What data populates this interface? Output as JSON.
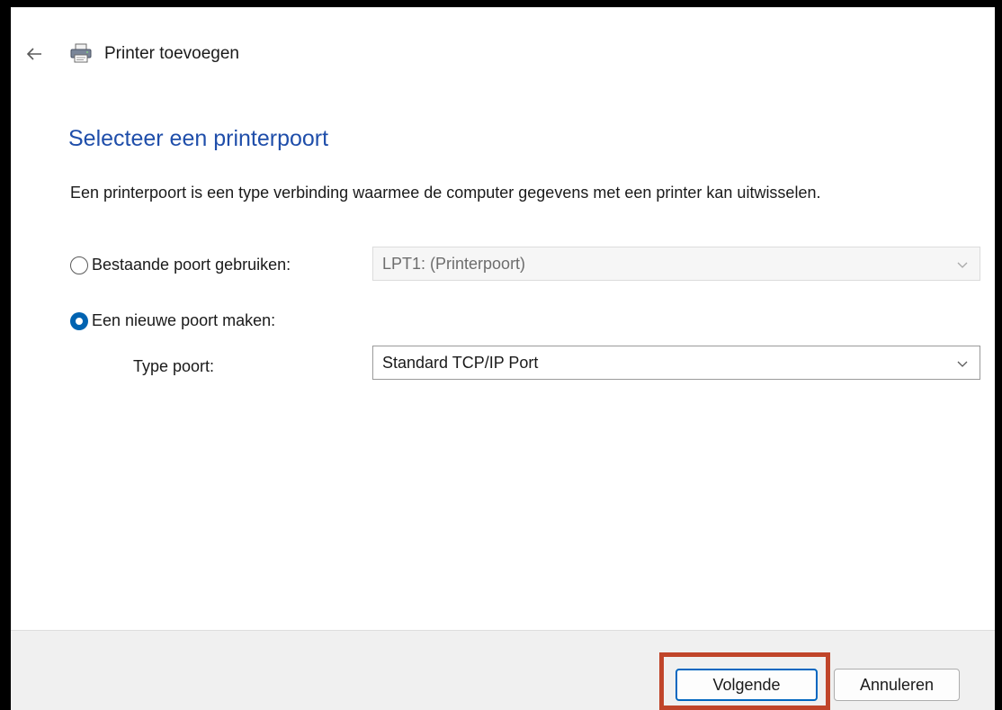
{
  "window": {
    "title": "Printer toevoegen",
    "icons": {
      "back": "back-arrow-icon",
      "title": "printer-icon"
    }
  },
  "page": {
    "heading": "Selecteer een printerpoort",
    "description": "Een printerpoort is een type verbinding waarmee de computer gegevens met een printer kan uitwisselen."
  },
  "options": {
    "existing_port": {
      "label": "Bestaande poort gebruiken:",
      "checked": false,
      "selected_value": "LPT1: (Printerpoort)",
      "enabled": false
    },
    "new_port": {
      "label": "Een nieuwe poort maken:",
      "checked": true,
      "type_label": "Type poort:",
      "selected_value": "Standard TCP/IP Port",
      "enabled": true
    }
  },
  "footer": {
    "next_label": "Volgende",
    "cancel_label": "Annuleren"
  },
  "colors": {
    "heading": "#1f4eaa",
    "accent": "#0063b1",
    "highlight": "#c0452a",
    "footer_bg": "#f0f0f0"
  }
}
